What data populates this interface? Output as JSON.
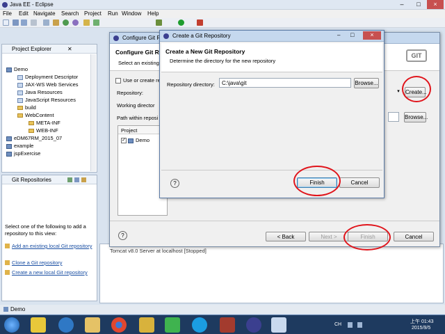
{
  "window": {
    "title": "Java EE - Eclipse"
  },
  "menu": [
    "File",
    "Edit",
    "Navigate",
    "Search",
    "Project",
    "Run",
    "Window",
    "Help"
  ],
  "project_explorer": {
    "title": "Project Explorer",
    "items": [
      {
        "label": "Demo"
      },
      {
        "label": "Deployment Descriptor"
      },
      {
        "label": "JAX-WS Web Services"
      },
      {
        "label": "Java Resources"
      },
      {
        "label": "JavaScript Resources"
      },
      {
        "label": "build"
      },
      {
        "label": "WebContent"
      },
      {
        "label": "META-INF"
      },
      {
        "label": "WEB-INF"
      },
      {
        "label": "eDM67RM_2015_07"
      },
      {
        "label": "example"
      },
      {
        "label": "jspExercise"
      }
    ]
  },
  "git_repos": {
    "title": "Git Repositories",
    "intro": "Select one of the following to add a repository to this view:",
    "links": [
      "Add an existing local Git repository",
      "Clone a Git repository",
      "Create a new local Git repository"
    ]
  },
  "status_bar": {
    "text": "Demo"
  },
  "configure": {
    "title": "Configure Git Repository",
    "heading": "Configure Git Re",
    "subtitle": "Select an existing",
    "use_or_create": "Use or create re",
    "repository_label": "Repository:",
    "create_button": "Create...",
    "working_dir_label": "Working director",
    "browse_button": "Browse...",
    "path_label": "Path within reposi",
    "table_header": "Project",
    "table_rows": [
      {
        "name": "Demo"
      }
    ],
    "back_button": "< Back",
    "next_button": "Next >",
    "finish_button": "Finish",
    "cancel_button": "Cancel",
    "server_text": "Tomcat v8.0 Server at localhost  [Stopped]"
  },
  "create_repo": {
    "title": "Create a Git Repository",
    "heading": "Create a New Git Repository",
    "subtitle": "Determine the directory for the new repository",
    "dir_label": "Repository directory:",
    "dir_value": "C:\\java\\git",
    "browse_button": "Browse...",
    "help_icon_text": "?",
    "finish_button": "Finish",
    "cancel_button": "Cancel"
  },
  "git_logo": "GIT",
  "clock": {
    "time": "01:43",
    "date": "2015/9/5",
    "ime": "CH"
  },
  "colors": {
    "annotation": "#e0141b",
    "link": "#1a4fa3"
  }
}
